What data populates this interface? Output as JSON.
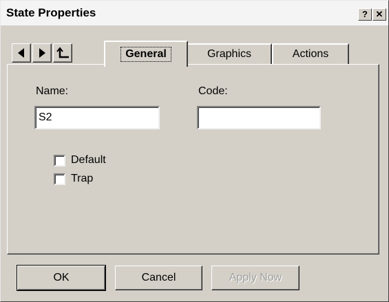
{
  "window": {
    "title": "State Properties",
    "help_label": "?",
    "close_label": "✕"
  },
  "nav": {
    "back_icon": "left-arrow-icon",
    "forward_icon": "right-arrow-icon",
    "up_icon": "parent-arrow-icon"
  },
  "tabs": [
    {
      "label": "General",
      "active": true
    },
    {
      "label": "Graphics",
      "active": false
    },
    {
      "label": "Actions",
      "active": false
    }
  ],
  "form": {
    "name_label": "Name:",
    "name_value": "S2",
    "code_label": "Code:",
    "code_value": "",
    "checkboxes": [
      {
        "label": "Default",
        "checked": false
      },
      {
        "label": "Trap",
        "checked": false
      }
    ]
  },
  "buttons": {
    "ok": "OK",
    "cancel": "Cancel",
    "apply": "Apply Now"
  }
}
